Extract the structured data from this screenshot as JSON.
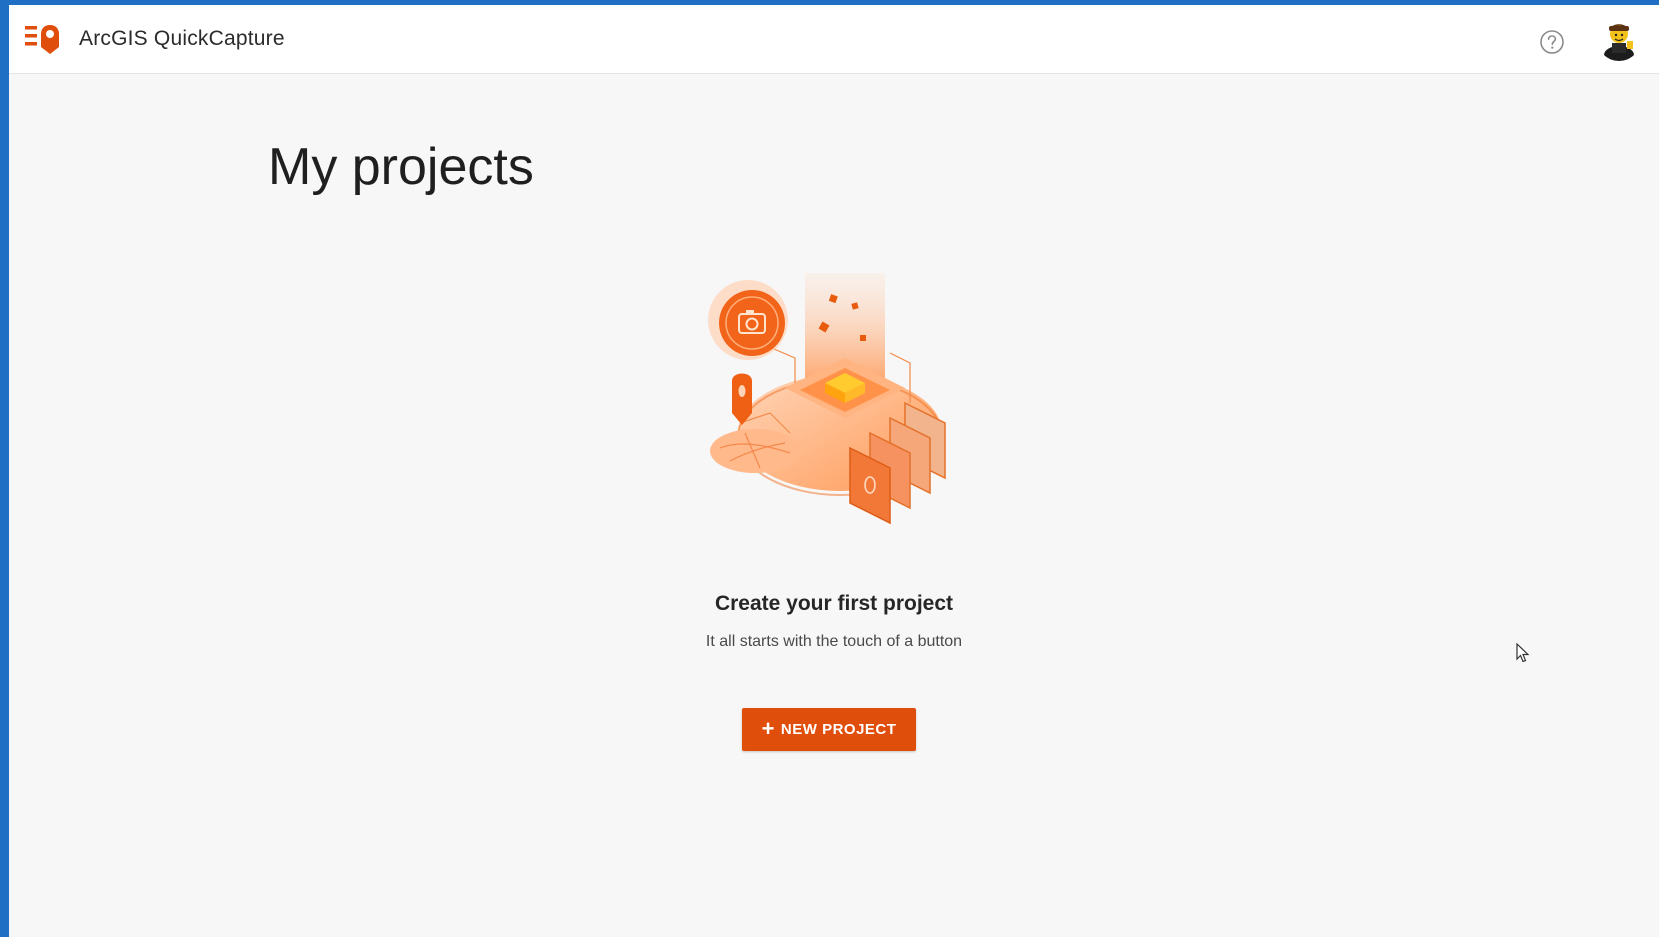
{
  "header": {
    "app_title": "ArcGIS QuickCapture",
    "logo_icon": "quickcapture-logo-icon",
    "help_icon": "help-circle-icon",
    "avatar_icon": "user-avatar"
  },
  "main": {
    "page_title": "My projects",
    "empty_state": {
      "heading": "Create your first project",
      "subtext": "It all starts with the touch of a button",
      "illustration_icon": "project-illustration"
    },
    "new_project_button": {
      "icon": "plus-icon",
      "label": "NEW PROJECT"
    }
  },
  "colors": {
    "accent": "#e04e0b",
    "background": "#f7f7f7",
    "header_bg": "#ffffff",
    "desktop_blue": "#1f6fc4"
  }
}
